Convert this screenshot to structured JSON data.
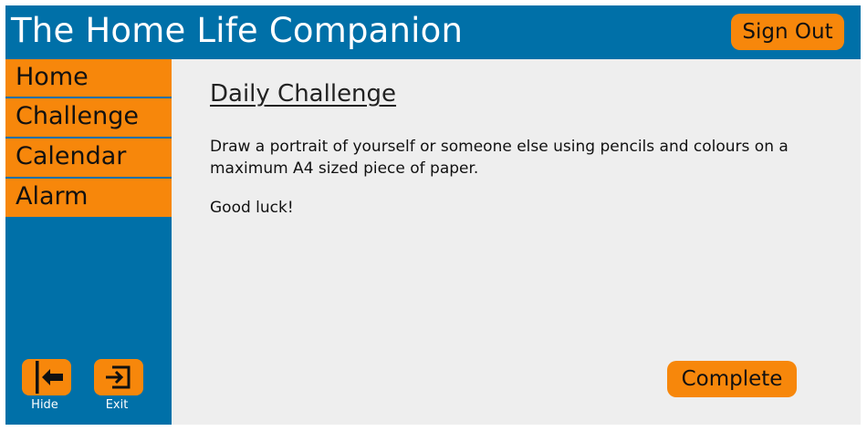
{
  "header": {
    "title": "The Home Life Companion",
    "sign_out_label": "Sign Out"
  },
  "sidebar": {
    "items": [
      {
        "label": "Home"
      },
      {
        "label": "Challenge"
      },
      {
        "label": "Calendar"
      },
      {
        "label": "Alarm"
      }
    ],
    "hide_label": "Hide",
    "exit_label": "Exit",
    "hide_icon": "collapse-left-icon",
    "exit_icon": "exit-icon"
  },
  "main": {
    "heading": "Daily Challenge",
    "description": "Draw a portrait of yourself or someone else using pencils and colours on a maximum A4 sized piece of paper.",
    "closing": "Good luck!",
    "complete_label": "Complete"
  },
  "colors": {
    "primary": "#0070a8",
    "accent": "#f7870b",
    "content_bg": "#eeeeee"
  }
}
